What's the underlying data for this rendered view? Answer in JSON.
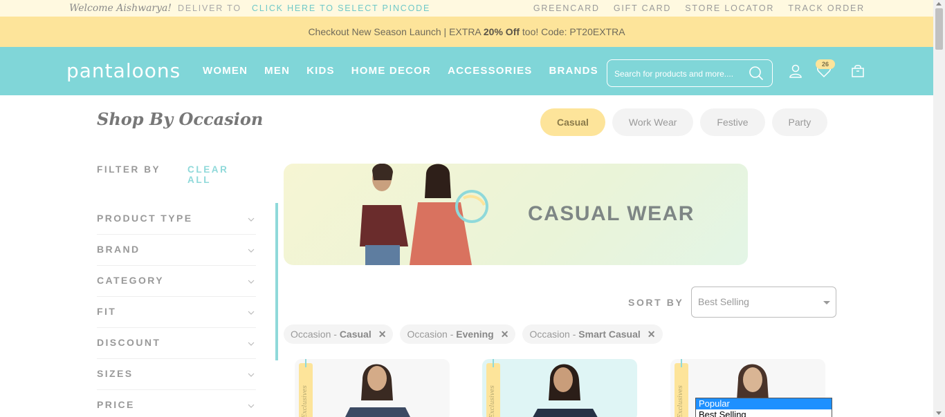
{
  "topbar": {
    "welcome": "Welcome Aishwarya!",
    "deliver_to": "DELIVER TO",
    "pincode_link": "CLICK HERE TO SELECT PINCODE",
    "links": [
      "GREENCARD",
      "GIFT CARD",
      "STORE LOCATOR",
      "TRACK ORDER"
    ]
  },
  "promo": {
    "prefix": "Checkout New Season Launch | EXTRA ",
    "bold": "20% Off",
    "suffix": " too! Code: PT20EXTRA"
  },
  "header": {
    "logo": "pantaloons",
    "nav": [
      "WOMEN",
      "MEN",
      "KIDS",
      "HOME DECOR",
      "ACCESSORIES",
      "BRANDS"
    ],
    "search_placeholder": "Search for products and more....",
    "wishlist_count": "26"
  },
  "page": {
    "title": "Shop By Occasion",
    "occasion_tabs": [
      {
        "label": "Casual",
        "active": true
      },
      {
        "label": "Work Wear",
        "active": false
      },
      {
        "label": "Festive",
        "active": false
      },
      {
        "label": "Party",
        "active": false
      }
    ]
  },
  "filters": {
    "heading": "FILTER BY",
    "clear_all": "CLEAR ALL",
    "items": [
      "PRODUCT TYPE",
      "BRAND",
      "CATEGORY",
      "FIT",
      "DISCOUNT",
      "SIZES",
      "PRICE"
    ]
  },
  "banner": {
    "title": "CASUAL WEAR"
  },
  "sort": {
    "label": "SORT BY",
    "selected": "Best Selling",
    "options_visible": [
      "Popular",
      "Best Selling"
    ]
  },
  "applied_chips": [
    {
      "prefix": "Occasion - ",
      "value": "Casual"
    },
    {
      "prefix": "Occasion - ",
      "value": "Evening"
    },
    {
      "prefix": "Occasion - ",
      "value": "Smart Casual"
    }
  ],
  "products": [
    {
      "tag": "Exclusives"
    },
    {
      "tag": "Exclusives"
    },
    {
      "tag": "Exclusives"
    }
  ],
  "colors": {
    "accent_teal": "#80d6d8",
    "accent_yellow": "#fde49a",
    "topbar_bg": "#fff9e0"
  }
}
